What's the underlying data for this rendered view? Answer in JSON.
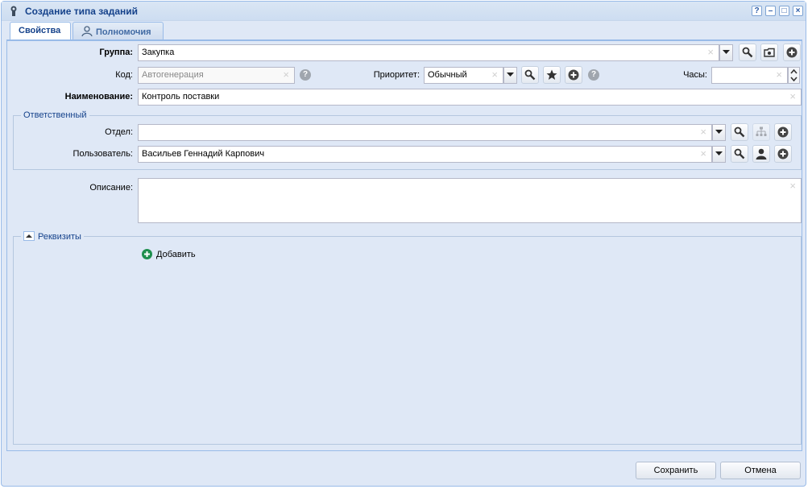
{
  "window": {
    "title": "Создание типа заданий",
    "tools": [
      "?",
      "–",
      "□",
      "×"
    ]
  },
  "tabs": [
    {
      "label": "Свойства",
      "active": true
    },
    {
      "label": "Полномочия",
      "active": false
    }
  ],
  "form": {
    "group_label": "Группа:",
    "group_value": "Закупка",
    "code_label": "Код:",
    "code_placeholder": "Автогенерация",
    "priority_label": "Приоритет:",
    "priority_value": "Обычный",
    "hours_label": "Часы:",
    "hours_value": "",
    "name_label": "Наименование:",
    "name_value": "Контроль поставки",
    "description_label": "Описание:",
    "description_value": ""
  },
  "responsible": {
    "legend": "Ответственный",
    "dept_label": "Отдел:",
    "dept_value": "",
    "user_label": "Пользователь:",
    "user_value": "Васильев Геннадий Карпович"
  },
  "requisites": {
    "legend": "Реквизиты",
    "add_label": "Добавить"
  },
  "footer": {
    "save_label": "Сохранить",
    "cancel_label": "Отмена"
  },
  "icons": {
    "help": "?",
    "clear": "×"
  },
  "colors": {
    "title": "#15428b",
    "accent_green": "#1e8f4e",
    "border": "#99bbe8"
  }
}
